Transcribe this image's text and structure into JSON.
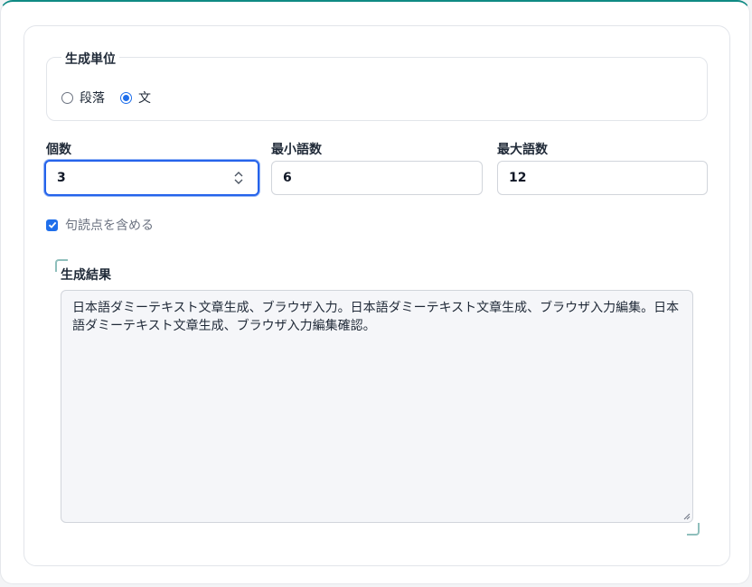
{
  "unit_group": {
    "legend": "生成単位",
    "options": [
      {
        "label": "段落",
        "checked": false
      },
      {
        "label": "文",
        "checked": true
      }
    ]
  },
  "fields": {
    "count": {
      "label": "個数",
      "value": "3"
    },
    "min_words": {
      "label": "最小語数",
      "value": "6"
    },
    "max_words": {
      "label": "最大語数",
      "value": "12"
    }
  },
  "punctuation": {
    "label": "句読点を含める",
    "checked": true
  },
  "result": {
    "label": "生成結果",
    "text": "日本語ダミーテキスト文章生成、ブラウザ入力。日本語ダミーテキスト文章生成、ブラウザ入力編集。日本語ダミーテキスト文章生成、ブラウザ入力編集確認。"
  },
  "colors": {
    "accent": "#1f6feb",
    "top_border": "#0f8a84"
  }
}
